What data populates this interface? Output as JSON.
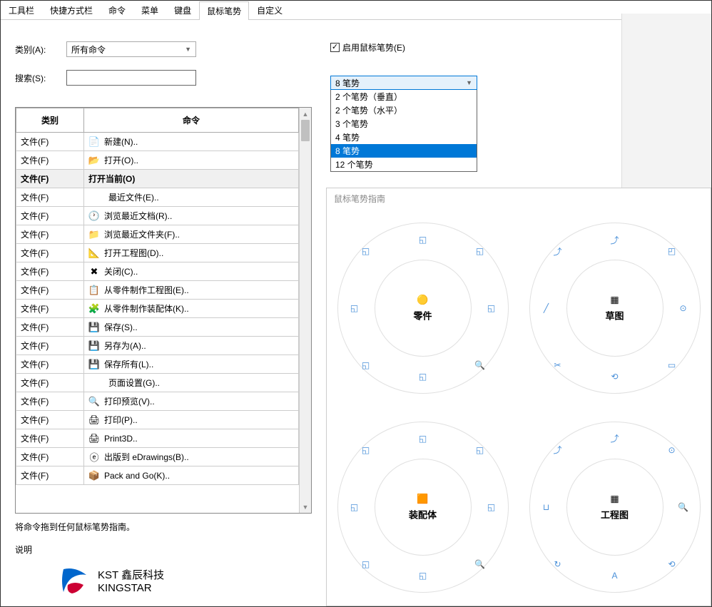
{
  "tabs": [
    "工具栏",
    "快捷方式栏",
    "命令",
    "菜单",
    "键盘",
    "鼠标笔势",
    "自定义"
  ],
  "active_tab": 5,
  "labels": {
    "category": "类别(A):",
    "search": "搜索(S):",
    "enable_gesture": "启用鼠标笔势(E)",
    "hint": "将命令拖到任何鼠标笔势指南。",
    "description": "说明",
    "guide_title": "鼠标笔势指南"
  },
  "category_value": "所有命令",
  "search_value": "",
  "gesture_count_selected": "8 笔势",
  "gesture_count_options": [
    "2 个笔势（垂直）",
    "2 个笔势（水平）",
    "3 个笔势",
    "4 笔势",
    "8 笔势",
    "12 个笔势"
  ],
  "gesture_selected_index": 4,
  "table": {
    "headers": [
      "类别",
      "命令"
    ],
    "rows": [
      {
        "cat": "文件(F)",
        "icon": "📄",
        "cmd": "新建(N)..",
        "sel": false
      },
      {
        "cat": "文件(F)",
        "icon": "📂",
        "cmd": "打开(O)..",
        "sel": false
      },
      {
        "cat": "文件(F)",
        "icon": "",
        "cmd": "打开当前(O)",
        "sel": true
      },
      {
        "cat": "文件(F)",
        "icon": "",
        "cmd": "最近文件(E)..",
        "sel": false,
        "indent": true
      },
      {
        "cat": "文件(F)",
        "icon": "🕐",
        "cmd": "浏览最近文档(R)..",
        "sel": false
      },
      {
        "cat": "文件(F)",
        "icon": "📁",
        "cmd": "浏览最近文件夹(F)..",
        "sel": false
      },
      {
        "cat": "文件(F)",
        "icon": "📐",
        "cmd": "打开工程图(D)..",
        "sel": false
      },
      {
        "cat": "文件(F)",
        "icon": "✖",
        "cmd": "关闭(C)..",
        "sel": false
      },
      {
        "cat": "文件(F)",
        "icon": "📋",
        "cmd": "从零件制作工程图(E)..",
        "sel": false
      },
      {
        "cat": "文件(F)",
        "icon": "🧩",
        "cmd": "从零件制作装配体(K)..",
        "sel": false
      },
      {
        "cat": "文件(F)",
        "icon": "💾",
        "cmd": "保存(S)..",
        "sel": false
      },
      {
        "cat": "文件(F)",
        "icon": "💾",
        "cmd": "另存为(A)..",
        "sel": false
      },
      {
        "cat": "文件(F)",
        "icon": "💾",
        "cmd": "保存所有(L)..",
        "sel": false
      },
      {
        "cat": "文件(F)",
        "icon": "",
        "cmd": "页面设置(G)..",
        "sel": false,
        "indent": true
      },
      {
        "cat": "文件(F)",
        "icon": "🔍",
        "cmd": "打印预览(V)..",
        "sel": false
      },
      {
        "cat": "文件(F)",
        "icon": "🖨",
        "cmd": "打印(P)..",
        "sel": false
      },
      {
        "cat": "文件(F)",
        "icon": "🖨",
        "cmd": "Print3D..",
        "sel": false
      },
      {
        "cat": "文件(F)",
        "icon": "ⓔ",
        "cmd": "出版到 eDrawings(B)..",
        "sel": false
      },
      {
        "cat": "文件(F)",
        "icon": "📦",
        "cmd": "Pack and Go(K)..",
        "sel": false
      }
    ]
  },
  "logo": {
    "line1": "KST 鑫辰科技",
    "line2": "KINGSTAR"
  },
  "wheels": [
    {
      "label": "零件",
      "center_icon": "🟡",
      "items": [
        "◱",
        "◱",
        "◱",
        "🔍",
        "◱",
        "◱",
        "◱",
        "◱"
      ]
    },
    {
      "label": "草图",
      "center_icon": "▦",
      "items": [
        "⤴",
        "◰",
        "⊙",
        "▭",
        "⟲",
        "✂",
        "╱",
        "⤴"
      ]
    },
    {
      "label": "装配体",
      "center_icon": "🟧",
      "items": [
        "◱",
        "◱",
        "◱",
        "🔍",
        "◱",
        "◱",
        "◱",
        "◱"
      ]
    },
    {
      "label": "工程图",
      "center_icon": "▦",
      "items": [
        "⤴",
        "⊙",
        "🔍",
        "⟲",
        "A",
        "↻",
        "⊔",
        "⤴"
      ]
    }
  ]
}
